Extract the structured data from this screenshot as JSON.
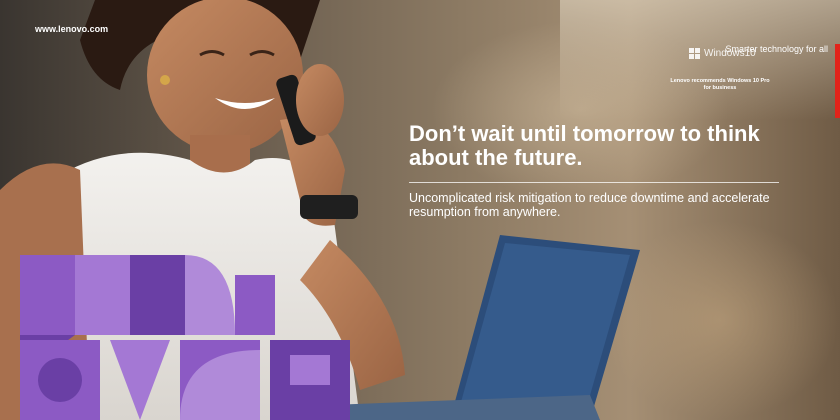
{
  "site_url": "www.lenovo.com",
  "windows_badge": {
    "logo_text": "Windows10",
    "recommendation": "Lenovo recommends Windows 10 Pro for business",
    "icon": "windows-logo-icon"
  },
  "brand_tagline": "Smarter technology for all",
  "headline": "Don’t wait until tomorrow to think about the future.",
  "subheadline": "Uncomplicated risk mitigation to reduce downtime and accelerate resumption from anywhere.",
  "colors": {
    "accent_purple": "#8c5ac4",
    "purple_dark": "#6a3fa5",
    "purple_light": "#b08ad9",
    "brand_red": "#e2231a",
    "text": "#ffffff"
  }
}
